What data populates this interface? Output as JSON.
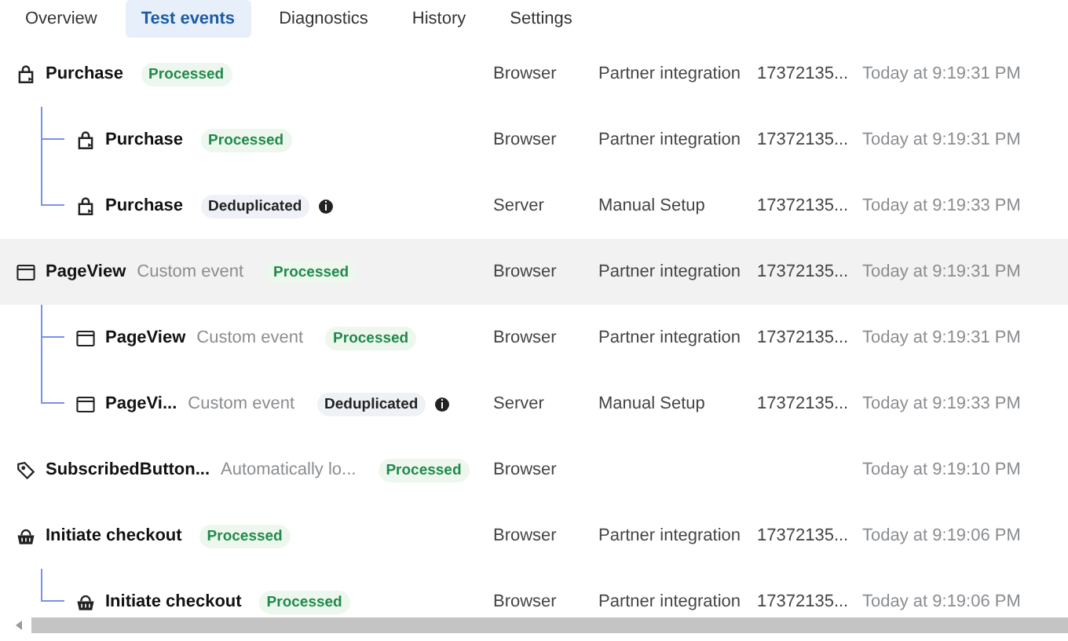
{
  "tabs": [
    {
      "label": "Overview",
      "selected": false
    },
    {
      "label": "Test events",
      "selected": true
    },
    {
      "label": "Diagnostics",
      "selected": false
    },
    {
      "label": "History",
      "selected": false
    },
    {
      "label": "Settings",
      "selected": false
    }
  ],
  "events": [
    {
      "kind": "purchase",
      "name": "Purchase",
      "badge": {
        "label": "Processed",
        "kind": "processed"
      },
      "info": false,
      "source": "Browser",
      "integration": "Partner integration",
      "event_id": "17372135...",
      "time": "Today at 9:19:31 PM",
      "selected": false,
      "children": [
        {
          "kind": "purchase",
          "name": "Purchase",
          "badge": {
            "label": "Processed",
            "kind": "processed"
          },
          "info": false,
          "source": "Browser",
          "integration": "Partner integration",
          "event_id": "17372135...",
          "time": "Today at 9:19:31 PM",
          "selected": false
        },
        {
          "kind": "purchase",
          "name": "Purchase",
          "badge": {
            "label": "Deduplicated",
            "kind": "deduplicated"
          },
          "info": true,
          "source": "Server",
          "integration": "Manual Setup",
          "event_id": "17372135...",
          "time": "Today at 9:19:33 PM",
          "selected": false
        }
      ]
    },
    {
      "kind": "page-view",
      "name": "PageView",
      "description": "Custom event",
      "badge": {
        "label": "Processed",
        "kind": "processed"
      },
      "info": false,
      "source": "Browser",
      "integration": "Partner integration",
      "event_id": "17372135...",
      "time": "Today at 9:19:31 PM",
      "selected": true,
      "children": [
        {
          "kind": "page-view",
          "name": "PageView",
          "description": "Custom event",
          "badge": {
            "label": "Processed",
            "kind": "processed"
          },
          "info": false,
          "source": "Browser",
          "integration": "Partner integration",
          "event_id": "17372135...",
          "time": "Today at 9:19:31 PM",
          "selected": false
        },
        {
          "kind": "page-view",
          "name": "PageVi...",
          "description": "Custom event",
          "badge": {
            "label": "Deduplicated",
            "kind": "deduplicated"
          },
          "info": true,
          "source": "Server",
          "integration": "Manual Setup",
          "event_id": "17372135...",
          "time": "Today at 9:19:33 PM",
          "selected": false
        }
      ]
    },
    {
      "kind": "button-click",
      "name": "SubscribedButton...",
      "description": "Automatically lo...",
      "badge": {
        "label": "Processed",
        "kind": "processed"
      },
      "info": false,
      "source": "Browser",
      "time": "Today at 9:19:10 PM",
      "selected": false
    },
    {
      "kind": "checkout",
      "name": "Initiate checkout",
      "badge": {
        "label": "Processed",
        "kind": "processed"
      },
      "info": false,
      "source": "Browser",
      "integration": "Partner integration",
      "event_id": "17372135...",
      "time": "Today at 9:19:06 PM",
      "selected": false,
      "children": [
        {
          "kind": "checkout",
          "name": "Initiate checkout",
          "badge": {
            "label": "Processed",
            "kind": "processed"
          },
          "info": false,
          "source": "Browser",
          "integration": "Partner integration",
          "event_id": "17372135...",
          "time": "Today at 9:19:06 PM",
          "selected": false
        }
      ]
    }
  ]
}
